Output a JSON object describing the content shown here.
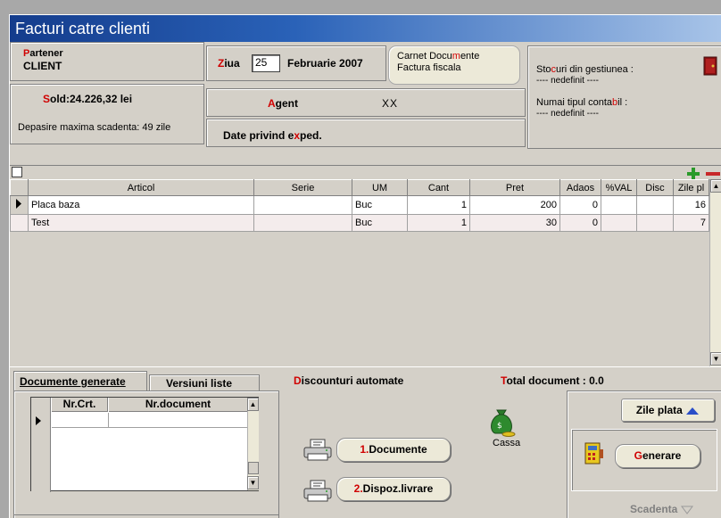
{
  "window": {
    "title": "Facturi catre clienti"
  },
  "partner": {
    "label_first": "P",
    "label_rest": "artener",
    "value": "CLIENT"
  },
  "date": {
    "label_first": "Z",
    "label_rest": "iua",
    "day": "25",
    "month_year": "Februarie 2007"
  },
  "carnet": {
    "line1_a": "Carnet Docu",
    "line1_b": "m",
    "line1_c": "ente",
    "line2": "Factura fiscala"
  },
  "stock": {
    "label_a": "Sto",
    "label_b": "c",
    "label_c": "uri din gestiunea :",
    "value": "---- nedefinit ----",
    "contabil_a": "Numai tipul conta",
    "contabil_b": "b",
    "contabil_c": "il :",
    "contabil_value": "---- nedefinit ----"
  },
  "balance": {
    "first": "S",
    "rest": "old:24.226,32 lei",
    "overdue": "Depasire maxima scadenta: 49 zile"
  },
  "agent": {
    "first": "A",
    "rest": "gent",
    "value": "XX"
  },
  "expedition": {
    "a": "Date privind e",
    "b": "x",
    "c": "ped."
  },
  "grid": {
    "columns": [
      "Articol",
      "Serie",
      "UM",
      "Cant",
      "Pret",
      "Adaos",
      "%VAL",
      "Disc",
      "Zile pl"
    ],
    "rows": [
      {
        "articol": "Placa baza",
        "serie": "",
        "um": "Buc",
        "cant": "1",
        "pret": "200",
        "adaos": "0",
        "val": "",
        "disc": "",
        "zile": "16"
      },
      {
        "articol": "Test",
        "serie": "",
        "um": "Buc",
        "cant": "1",
        "pret": "30",
        "adaos": "0",
        "val": "",
        "disc": "",
        "zile": "7"
      }
    ]
  },
  "tabs": {
    "generated": "Documente generate",
    "versions": "Versiuni liste"
  },
  "discounts": {
    "first": "D",
    "rest": "iscounturi automate"
  },
  "total": {
    "first": "T",
    "rest": "otal document : 0.0"
  },
  "docs_table": {
    "col_nr": "Nr.Crt.",
    "col_doc": "Nr.document"
  },
  "buttons": {
    "documents_num": "1.",
    "documents_label": "Documente",
    "dispoz_num": "2.",
    "dispoz_label": "Dispoz.livrare",
    "cassa": "Cassa",
    "zile_plata": "Zile plata",
    "generare_first": "G",
    "generare_rest": "enerare",
    "scadenta": "Scadenta"
  },
  "colors": {
    "accent_red": "#d00000",
    "title_blue": "#143c8c",
    "add_green": "#2a9a2a",
    "remove_red": "#c8282a"
  }
}
